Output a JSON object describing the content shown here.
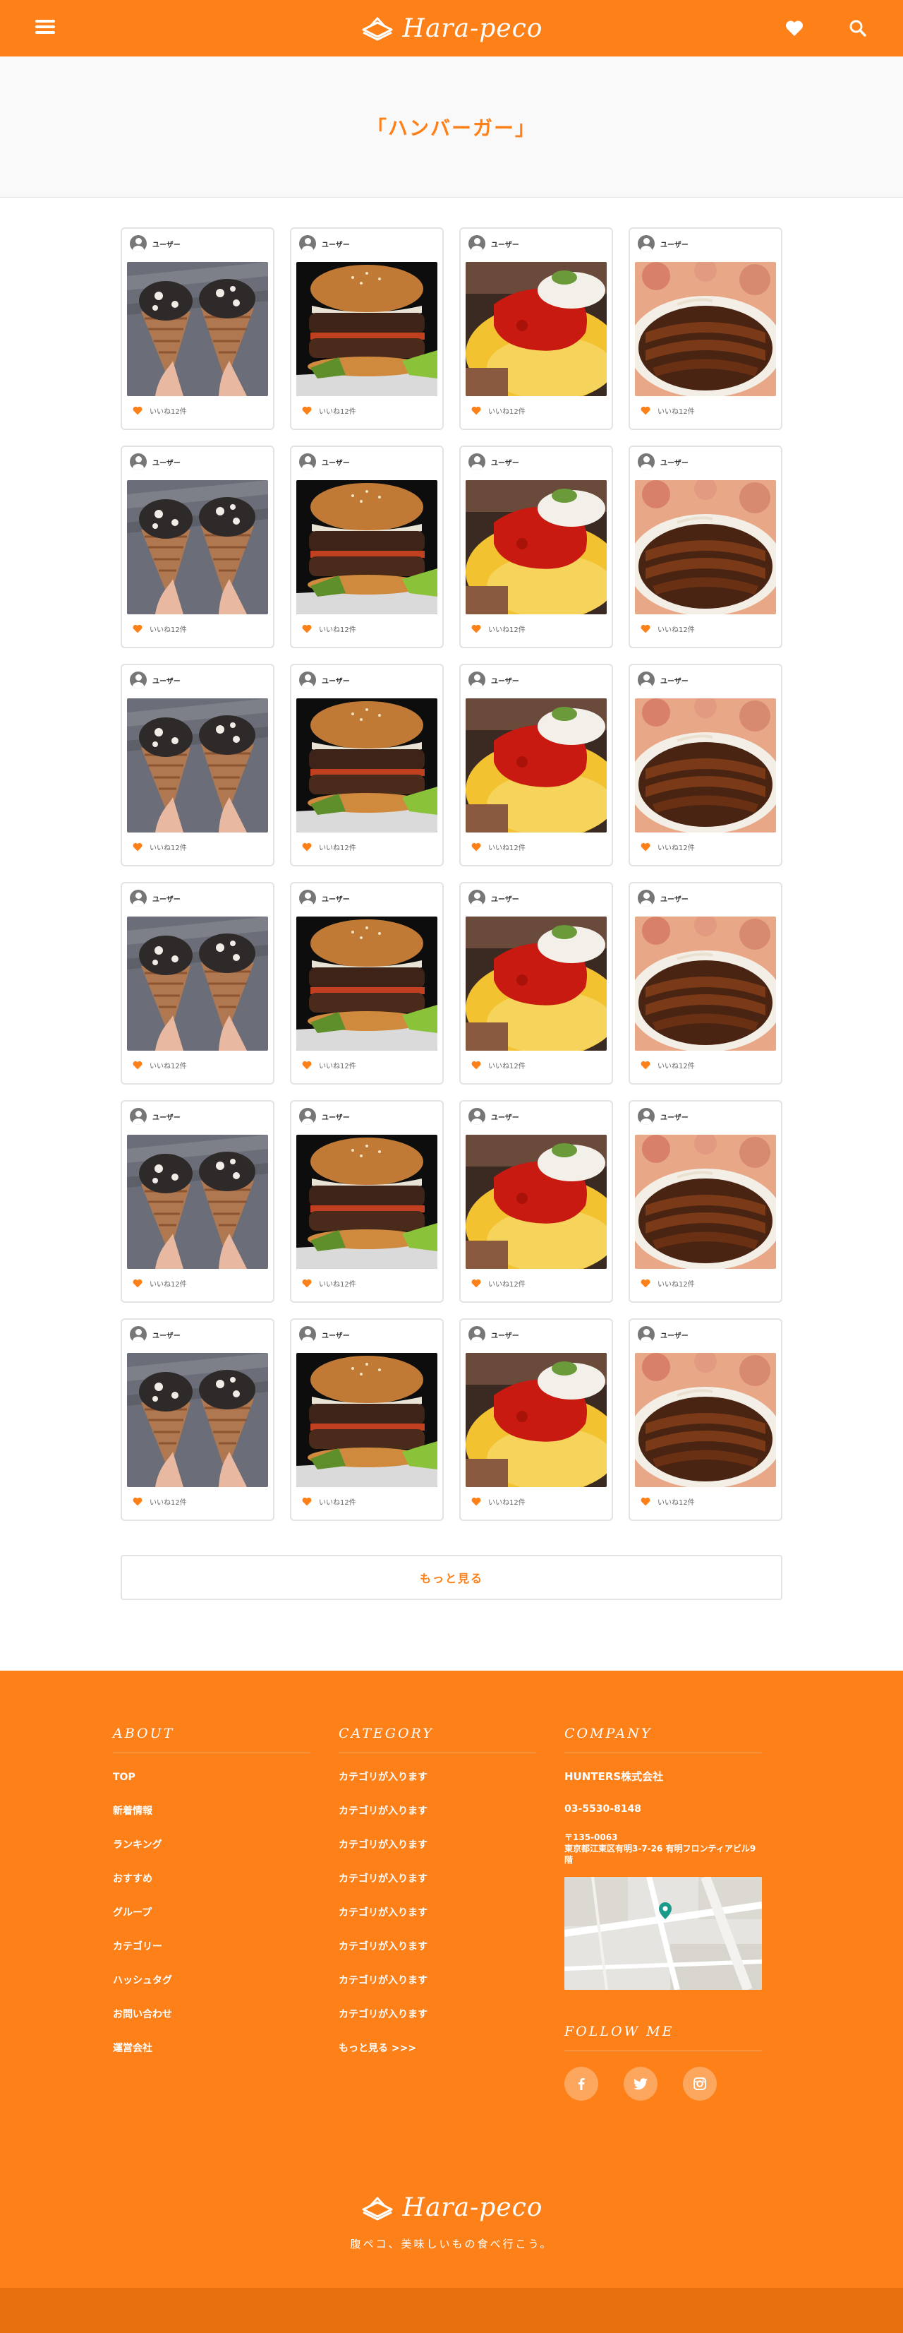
{
  "header": {
    "logo_text": "Hara-peco"
  },
  "hero": {
    "title": "「ハンバーガー」"
  },
  "cards": [
    {
      "user": "ユーザー",
      "likes": "いいね12件",
      "image": "ice-cream-cones"
    },
    {
      "user": "ユーザー",
      "likes": "いいね12件",
      "image": "hamburger"
    },
    {
      "user": "ユーザー",
      "likes": "いいね12件",
      "image": "omelette-rice"
    },
    {
      "user": "ユーザー",
      "likes": "いいね12件",
      "image": "unagi-don"
    },
    {
      "user": "ユーザー",
      "likes": "いいね12件",
      "image": "ice-cream-cones"
    },
    {
      "user": "ユーザー",
      "likes": "いいね12件",
      "image": "hamburger"
    },
    {
      "user": "ユーザー",
      "likes": "いいね12件",
      "image": "omelette-rice"
    },
    {
      "user": "ユーザー",
      "likes": "いいね12件",
      "image": "unagi-don"
    },
    {
      "user": "ユーザー",
      "likes": "いいね12件",
      "image": "ice-cream-cones"
    },
    {
      "user": "ユーザー",
      "likes": "いいね12件",
      "image": "hamburger"
    },
    {
      "user": "ユーザー",
      "likes": "いいね12件",
      "image": "omelette-rice"
    },
    {
      "user": "ユーザー",
      "likes": "いいね12件",
      "image": "unagi-don"
    },
    {
      "user": "ユーザー",
      "likes": "いいね12件",
      "image": "ice-cream-cones"
    },
    {
      "user": "ユーザー",
      "likes": "いいね12件",
      "image": "hamburger"
    },
    {
      "user": "ユーザー",
      "likes": "いいね12件",
      "image": "omelette-rice"
    },
    {
      "user": "ユーザー",
      "likes": "いいね12件",
      "image": "unagi-don"
    },
    {
      "user": "ユーザー",
      "likes": "いいね12件",
      "image": "ice-cream-cones"
    },
    {
      "user": "ユーザー",
      "likes": "いいね12件",
      "image": "hamburger"
    },
    {
      "user": "ユーザー",
      "likes": "いいね12件",
      "image": "omelette-rice"
    },
    {
      "user": "ユーザー",
      "likes": "いいね12件",
      "image": "unagi-don"
    },
    {
      "user": "ユーザー",
      "likes": "いいね12件",
      "image": "ice-cream-cones"
    },
    {
      "user": "ユーザー",
      "likes": "いいね12件",
      "image": "hamburger"
    },
    {
      "user": "ユーザー",
      "likes": "いいね12件",
      "image": "omelette-rice"
    },
    {
      "user": "ユーザー",
      "likes": "いいね12件",
      "image": "unagi-don"
    }
  ],
  "more_button": "もっと見る",
  "footer": {
    "about": {
      "heading": "ABOUT",
      "items": [
        "TOP",
        "新着情報",
        "ランキング",
        "おすすめ",
        "グループ",
        "カテゴリー",
        "ハッシュタグ",
        "お問い合わせ",
        "運営会社"
      ]
    },
    "category": {
      "heading": "CATEGORY",
      "items": [
        "カテゴリが入ります",
        "カテゴリが入ります",
        "カテゴリが入ります",
        "カテゴリが入ります",
        "カテゴリが入ります",
        "カテゴリが入ります",
        "カテゴリが入ります",
        "カテゴリが入ります",
        "もっと見る >>>"
      ]
    },
    "company": {
      "heading": "COMPANY",
      "name": "HUNTERS株式会社",
      "tel": "03-5530-8148",
      "zip": "〒135-0063",
      "address": "東京都江東区有明3-7-26 有明フロンティアビル9階"
    },
    "follow": {
      "heading": "FOLLOW ME",
      "icons": [
        "facebook-icon",
        "twitter-icon",
        "instagram-icon"
      ]
    },
    "brand": "Hara-peco",
    "tagline": "腹ペコ、美味しいもの食べ行こう。"
  },
  "colors": {
    "accent": "#fd8019",
    "footer_bar": "#e8700e"
  }
}
